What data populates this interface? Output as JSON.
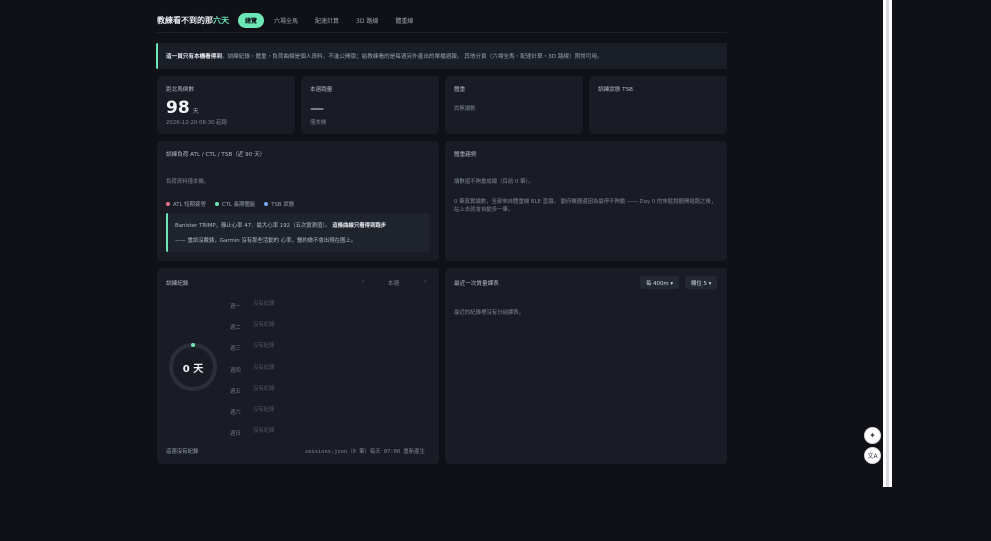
{
  "header": {
    "brand_main": "教練看不到的那",
    "brand_accent": "六天",
    "tabs": [
      {
        "label": "總覽",
        "active": true
      },
      {
        "label": "六場全馬",
        "active": false
      },
      {
        "label": "配速計算",
        "active": false
      },
      {
        "label": "3D 路線",
        "active": false
      },
      {
        "label": "體重線",
        "active": false
      }
    ]
  },
  "banner": {
    "bold": "這一頁只有本機看得到",
    "text": "。訓練紀錄・體重・負荷曲線是個人資料，不進公開版；給教練看的是每週另外產出的單檔週報。 其他分頁（六場全馬・配速計算・3D 路線）照常可用。"
  },
  "stats": [
    {
      "title": "距北馬倒數",
      "value": "98",
      "unit": "天",
      "sub": "2026-12-20 06:30 起跑"
    },
    {
      "title": "本週跑量",
      "value": "—",
      "sub": "僅本機"
    },
    {
      "title": "體重",
      "sub": "尚無讀數"
    },
    {
      "title": "訓練狀態 TSB"
    }
  ],
  "load": {
    "title": "訓練負荷 ATL / CTL / TSB（近 90 天）",
    "status": "負荷資料僅本機。",
    "legend": [
      {
        "label": "ATL 短期疲勞",
        "color": "#f06c8a"
      },
      {
        "label": "CTL 長期體能",
        "color": "#6ee7b7"
      },
      {
        "label": "TSB 狀態",
        "color": "#7aa7f5"
      }
    ],
    "note_line1": "Banister TRIMP，靜止心率 47．最大心率 192（五次實測值）。",
    "note_line1_bold": "這條曲線只看得到跑步",
    "note_line2": "—— 重訓沒戴錶，Garmin 沒有那些活動的 心率，醫約做不會出現在圖上。"
  },
  "weight": {
    "title": "體重趨勢",
    "status": "讀數還不夠畫成線（目前 0 筆）。",
    "desc": "0 筆真實讀數，全部來自體重機 BLE 直讀。 動府機器還因為最停不夠動 —— Day 0 的來駐脫觀開始跑之後，站上去就會自動多一筆。"
  },
  "training": {
    "title": "訓練紀錄",
    "prev": "‹",
    "week_label": "本週",
    "next": "›",
    "ring_value": "0 天",
    "days": [
      {
        "day": "週一",
        "status": "沒有紀錄"
      },
      {
        "day": "週二",
        "status": "沒有紀錄"
      },
      {
        "day": "週三",
        "status": "沒有紀錄"
      },
      {
        "day": "週四",
        "status": "沒有紀錄"
      },
      {
        "day": "週五",
        "status": "沒有紀錄"
      },
      {
        "day": "週六",
        "status": "沒有紀錄"
      },
      {
        "day": "週日",
        "status": "沒有紀錄"
      }
    ],
    "footer_left": "這週沒有紀錄",
    "footer_right": "sessions.json（0 筆）每天 07:00 重新產生"
  },
  "splits": {
    "title": "最近一次質量課表",
    "dropdown1": "每 400m ▾",
    "dropdown2": "欄位 5 ▾",
    "status": "最近的紀錄裡沒有分組課表。"
  },
  "fab": {
    "sparkle_icon": "✦",
    "translate_icon": "文A"
  },
  "colors": {
    "accent": "#6ee7b7",
    "card": "#191c24",
    "bg": "#0f1116"
  }
}
